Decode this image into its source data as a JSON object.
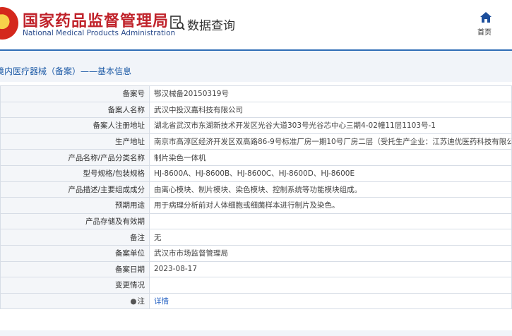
{
  "header": {
    "brand_cn": "国家药品监督管理局",
    "brand_en": "National Medical Products Administration",
    "query_title": "数据查询",
    "home_label": "首页"
  },
  "section": {
    "title": "境内医疗器械（备案）——基本信息"
  },
  "rows": [
    {
      "label": "备案号",
      "value": "鄂汉械备20150319号"
    },
    {
      "label": "备案人名称",
      "value": "武汉中投汉嘉科技有限公司"
    },
    {
      "label": "备案人注册地址",
      "value": "湖北省武汉市东湖新技术开发区光谷大道303号光谷芯中心三期4-02幢11层1103号-1"
    },
    {
      "label": "生产地址",
      "value": "南京市高淳区经济开发区双高路86-9号标准厂房一期10号厂房二层（受托生产企业：江苏迪优医药科技有限公司）"
    },
    {
      "label": "产品名称/产品分类名称",
      "value": "制片染色一体机"
    },
    {
      "label": "型号规格/包装规格",
      "value": "HJ-8600A、HJ-8600B、HJ-8600C、HJ-8600D、HJ-8600E"
    },
    {
      "label": "产品描述/主要组成成分",
      "value": "由离心模块、制片模块、染色模块、控制系统等功能模块组成。"
    },
    {
      "label": "预期用途",
      "value": "用于病理分析前对人体细胞或细菌样本进行制片及染色。"
    },
    {
      "label": "产品存储及有效期",
      "value": ""
    },
    {
      "label": "备注",
      "value": "无"
    },
    {
      "label": "备案单位",
      "value": "武汉市市场监督管理局"
    },
    {
      "label": "备案日期",
      "value": "2023-08-17"
    },
    {
      "label": "变更情况",
      "value": ""
    }
  ],
  "note": {
    "label": "注",
    "link": "详情"
  },
  "colors": {
    "brand_red": "#c0232b",
    "brand_blue": "#2b4c8c",
    "accent_line": "#2e6db5",
    "link": "#2a65c4"
  },
  "icons": {
    "logo": "national-emblem-icon",
    "query": "document-search-icon",
    "home": "home-icon",
    "note": "location-pin-icon"
  }
}
